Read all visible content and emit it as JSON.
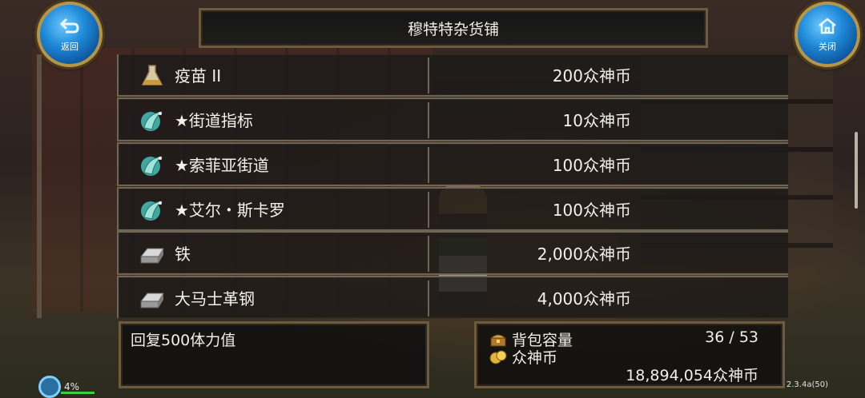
{
  "header": {
    "title": "穆特特杂货铺",
    "back_label": "返回",
    "close_label": "关闭"
  },
  "shop_items": [
    {
      "name": "疫苗 II",
      "price": "200众神币",
      "icon": "potion-flask-icon"
    },
    {
      "name": "★街道指标",
      "price": "10众神币",
      "icon": "teleport-scroll-icon"
    },
    {
      "name": "★索菲亚街道",
      "price": "100众神币",
      "icon": "teleport-scroll-icon"
    },
    {
      "name": "★艾尔・斯卡罗",
      "price": "100众神币",
      "icon": "teleport-scroll-icon"
    },
    {
      "name": "铁",
      "price": "2,000众神币",
      "icon": "iron-ingot-icon"
    },
    {
      "name": "大马士革钢",
      "price": "4,000众神币",
      "icon": "iron-ingot-icon"
    }
  ],
  "description": "回复500体力值",
  "inventory": {
    "bag_label": "背包容量",
    "bag_count": "36 / 53",
    "coin_label": "众神币",
    "coin_amount": "18,894,054众神币"
  },
  "status": {
    "energy_percent": "4%",
    "version": "2.3.4a(50)"
  },
  "colors": {
    "frame": "#6e5a3c",
    "button_blue": "#1f8ad8",
    "energy_green": "#3ccf3c"
  }
}
